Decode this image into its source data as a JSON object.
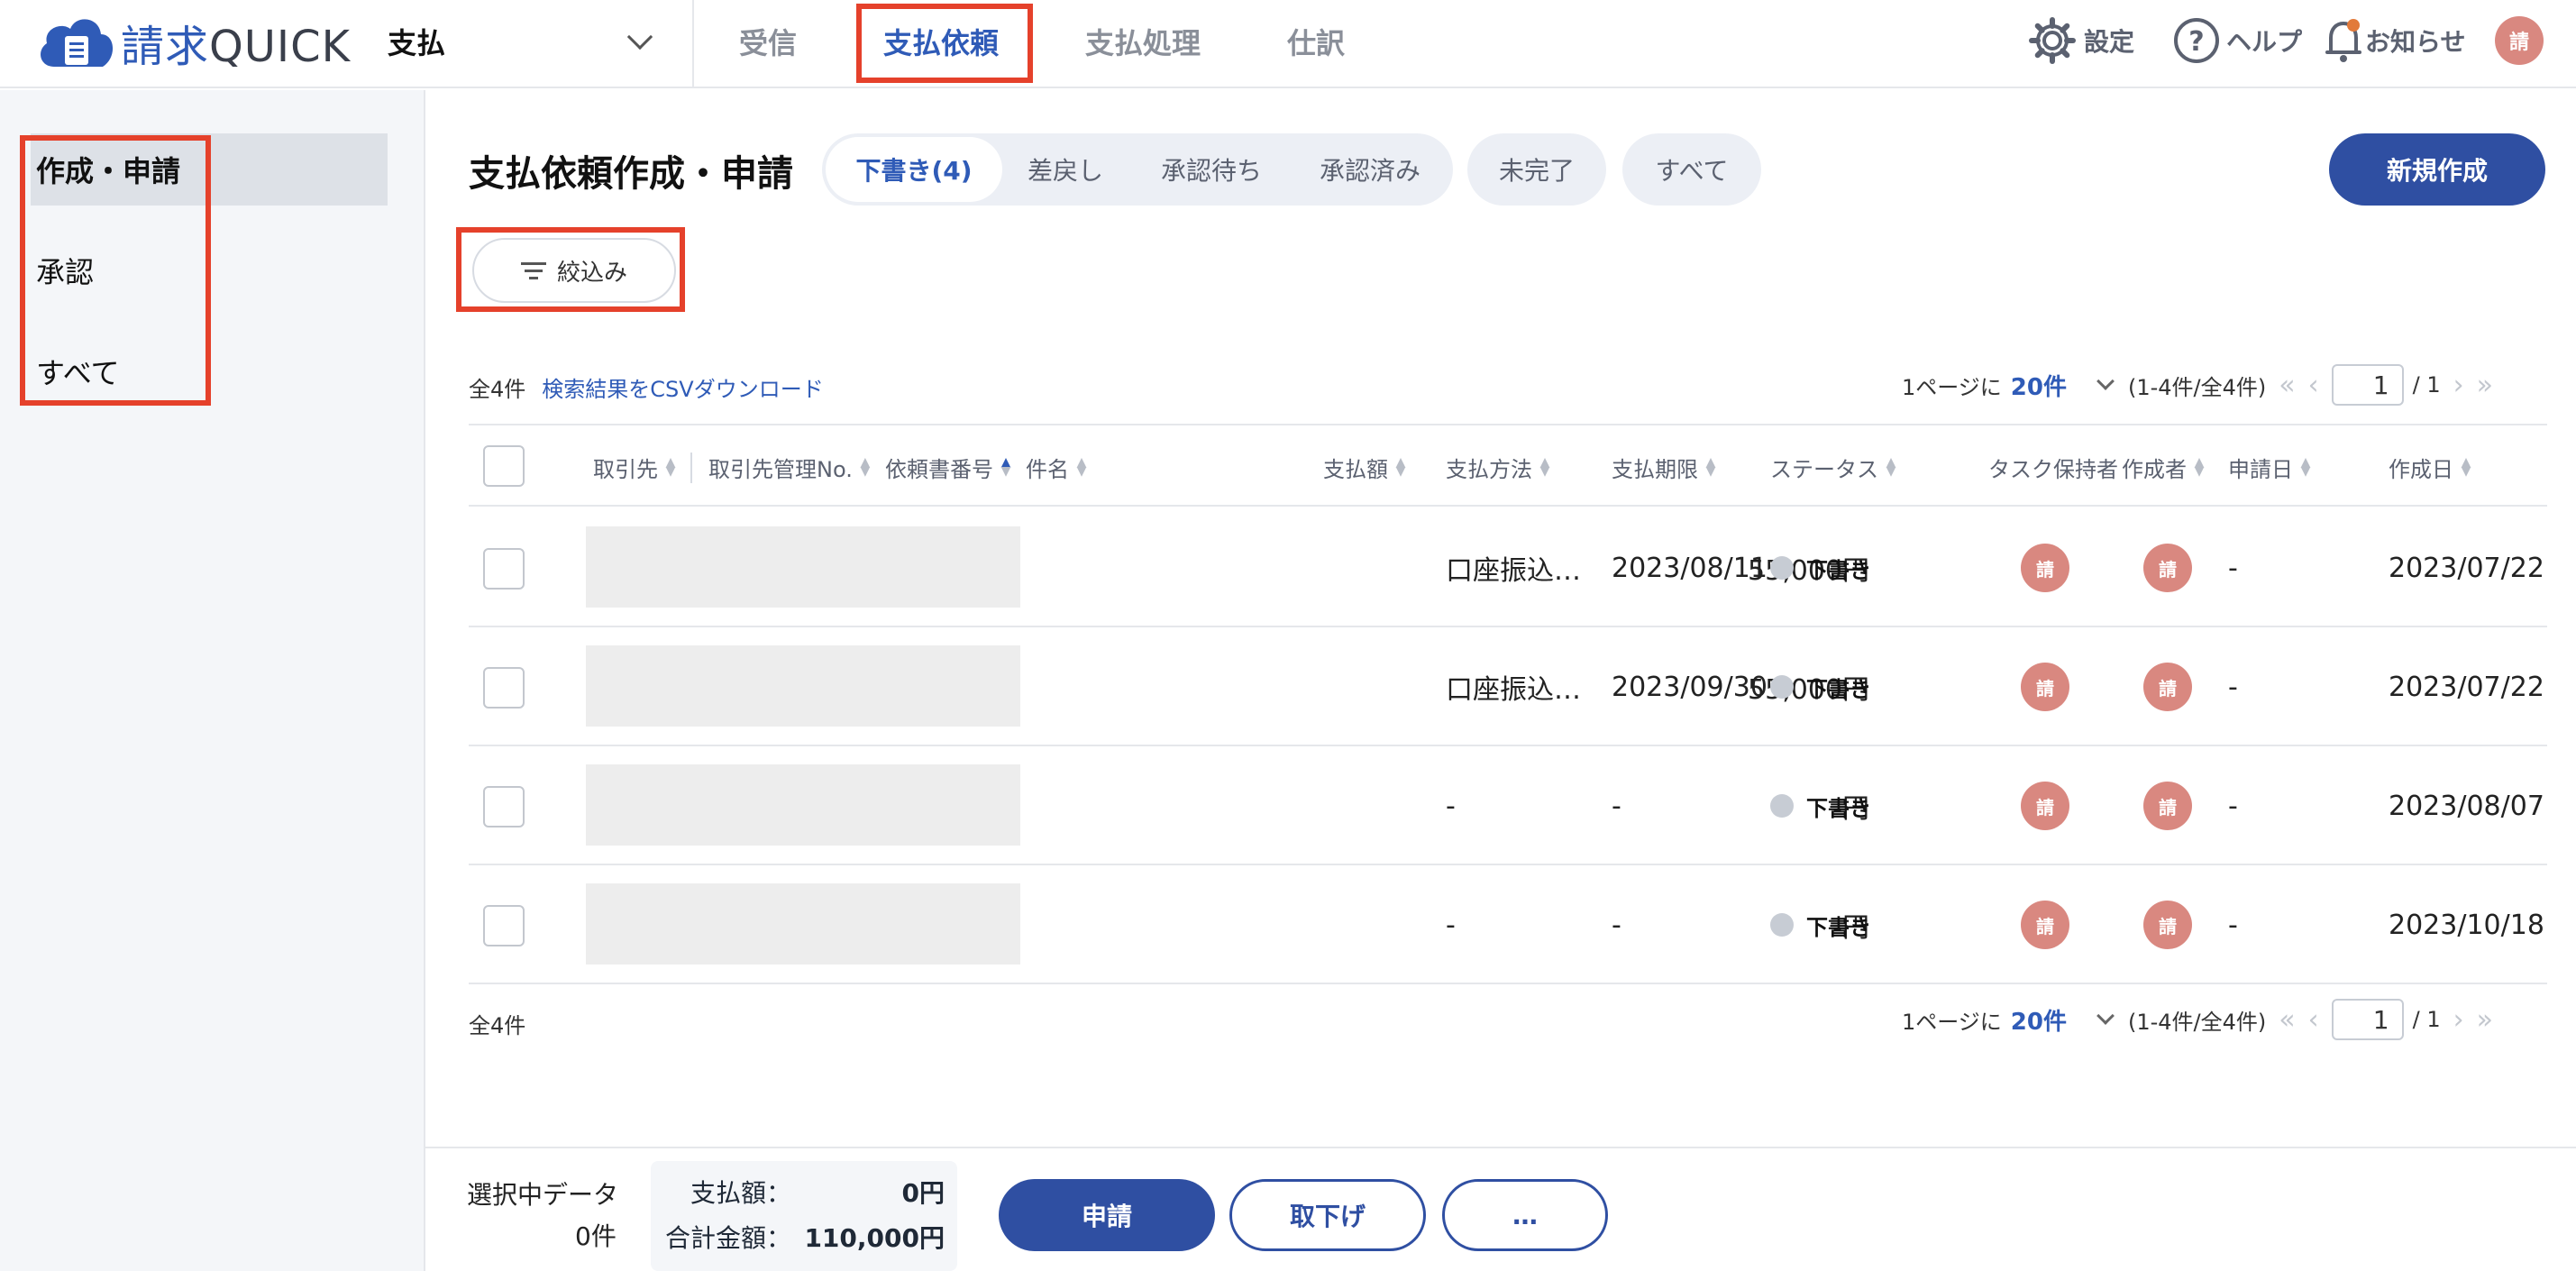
{
  "header": {
    "logo_kanji": "請求",
    "logo_latin": "QUICK",
    "module": "支払",
    "tabs": [
      {
        "label": "受信"
      },
      {
        "label": "支払依頼"
      },
      {
        "label": "支払処理"
      },
      {
        "label": "仕訳"
      }
    ],
    "settings_label": "設定",
    "help_label": "ヘルプ",
    "notice_label": "お知らせ",
    "avatar": "請"
  },
  "sidebar": {
    "items": [
      {
        "label": "作成・申請"
      },
      {
        "label": "承認"
      },
      {
        "label": "すべて"
      }
    ]
  },
  "main": {
    "title": "支払依頼作成・申請",
    "status_tabs": [
      {
        "label": "下書き(4)"
      },
      {
        "label": "差戻し"
      },
      {
        "label": "承認待ち"
      },
      {
        "label": "承認済み"
      }
    ],
    "extra_tabs": [
      {
        "label": "未完了"
      },
      {
        "label": "すべて"
      }
    ],
    "new_button": "新規作成",
    "filter_button": "絞込み",
    "total_count": "全4件",
    "csv_link": "検索結果をCSVダウンロード",
    "pager": {
      "per_page_prefix": "1ページに",
      "per_page": "20件",
      "range": "(1-4件/全4件)",
      "page_first": "«",
      "page_prev": "‹",
      "page_next": "›",
      "page_last": "»",
      "current_page": "1",
      "total_pages": "/ 1"
    }
  },
  "table": {
    "columns": [
      {
        "label": "取引先"
      },
      {
        "label": "取引先管理No."
      },
      {
        "label": "依頼書番号"
      },
      {
        "label": "件名"
      },
      {
        "label": "支払額"
      },
      {
        "label": "支払方法"
      },
      {
        "label": "支払期限"
      },
      {
        "label": "ステータス"
      },
      {
        "label": "タスク保持者"
      },
      {
        "label": "作成者"
      },
      {
        "label": "申請日"
      },
      {
        "label": "作成日"
      }
    ],
    "rows": [
      {
        "amount": "55,000円",
        "method": "口座振込…",
        "due": "2023/08/11",
        "status": "下書き",
        "task_holder": "請",
        "creator": "請",
        "applied": "-",
        "created": "2023/07/22"
      },
      {
        "amount": "55,000円",
        "method": "口座振込…",
        "due": "2023/09/30",
        "status": "下書き",
        "task_holder": "請",
        "creator": "請",
        "applied": "-",
        "created": "2023/07/22"
      },
      {
        "amount": "-円",
        "method": "-",
        "due": "-",
        "status": "下書き",
        "task_holder": "請",
        "creator": "請",
        "applied": "-",
        "created": "2023/08/07"
      },
      {
        "amount": "-円",
        "method": "-",
        "due": "-",
        "status": "下書き",
        "task_holder": "請",
        "creator": "請",
        "applied": "-",
        "created": "2023/10/18"
      }
    ]
  },
  "footer": {
    "selected_label": "選択中データ",
    "selected_count": "0件",
    "pay_label": "支払額：",
    "pay_value": "0円",
    "total_label": "合計金額：",
    "total_value": "110,000円",
    "apply_button": "申請",
    "withdraw_button": "取下げ",
    "more_button": "…"
  },
  "colors": {
    "accent": "#2f4fa2",
    "highlight": "#e5412b",
    "avatar": "#d98880"
  }
}
